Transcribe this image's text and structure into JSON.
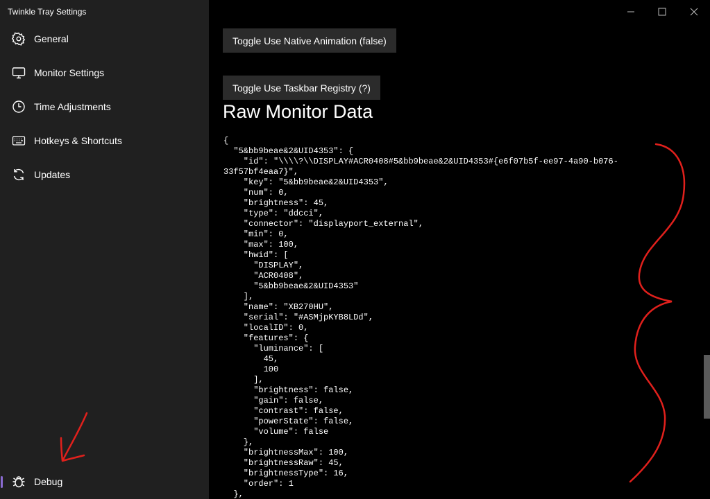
{
  "app": {
    "title": "Twinkle Tray Settings"
  },
  "sidebar": {
    "items": [
      {
        "label": "General",
        "icon": "gear-icon"
      },
      {
        "label": "Monitor Settings",
        "icon": "monitor-icon"
      },
      {
        "label": "Time Adjustments",
        "icon": "clock-icon"
      },
      {
        "label": "Hotkeys & Shortcuts",
        "icon": "keyboard-icon"
      },
      {
        "label": "Updates",
        "icon": "refresh-icon"
      }
    ],
    "debug": {
      "label": "Debug",
      "icon": "bug-icon",
      "active": true
    },
    "accent_color": "#8a6bd1"
  },
  "main": {
    "buttons": {
      "native_animation": "Toggle Use Native Animation (false)",
      "taskbar_registry": "Toggle Use Taskbar Registry (?)"
    },
    "section_title": "Raw Monitor Data",
    "raw_data": "{\n  \"5&bb9beae&2&UID4353\": {\n    \"id\": \"\\\\\\\\?\\\\DISPLAY#ACR0408#5&bb9beae&2&UID4353#{e6f07b5f-ee97-4a90-b076-\n33f57bf4eaa7}\",\n    \"key\": \"5&bb9beae&2&UID4353\",\n    \"num\": 0,\n    \"brightness\": 45,\n    \"type\": \"ddcci\",\n    \"connector\": \"displayport_external\",\n    \"min\": 0,\n    \"max\": 100,\n    \"hwid\": [\n      \"DISPLAY\",\n      \"ACR0408\",\n      \"5&bb9beae&2&UID4353\"\n    ],\n    \"name\": \"XB270HU\",\n    \"serial\": \"#ASMjpKYB8LDd\",\n    \"localID\": 0,\n    \"features\": {\n      \"luminance\": [\n        45,\n        100\n      ],\n      \"brightness\": false,\n      \"gain\": false,\n      \"contrast\": false,\n      \"powerState\": false,\n      \"volume\": false\n    },\n    \"brightnessMax\": 100,\n    \"brightnessRaw\": 45,\n    \"brightnessType\": 16,\n    \"order\": 1\n  },"
  },
  "annotation_color": "#e0201c"
}
